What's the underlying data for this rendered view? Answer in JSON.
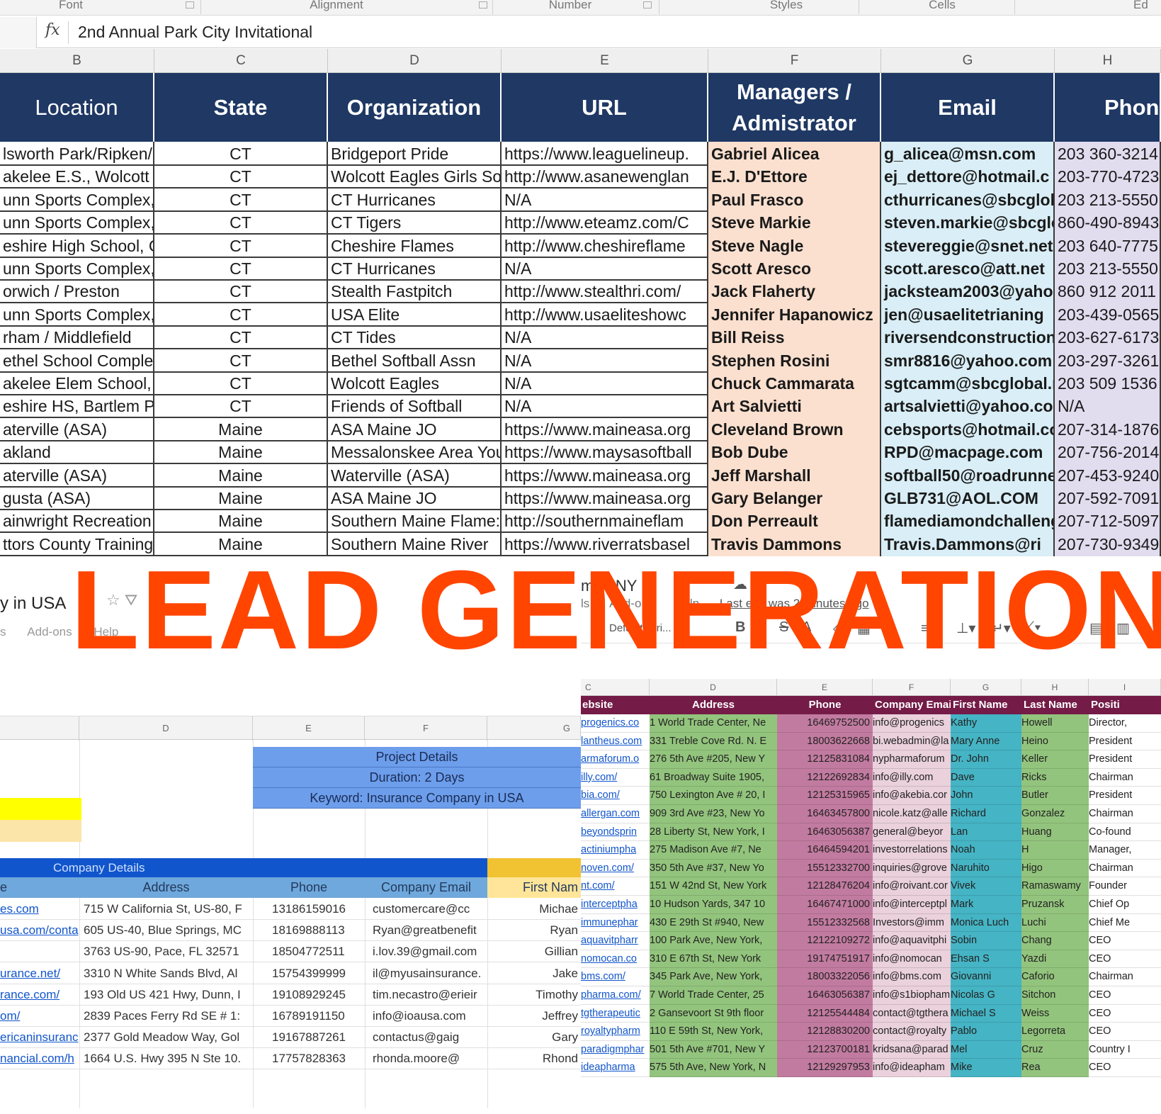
{
  "excel": {
    "ribbon_groups": [
      "Font",
      "Alignment",
      "Number",
      "Styles",
      "Cells",
      "Ed"
    ],
    "formula_bar": {
      "fx": "fx",
      "content": "2nd Annual Park City Invitational"
    },
    "column_letters": [
      "B",
      "C",
      "D",
      "E",
      "F",
      "G",
      "H"
    ],
    "headers": [
      "Location",
      "State",
      "Organization",
      "URL",
      "Managers / Admistrator",
      "Email",
      "Phon"
    ],
    "rows": [
      [
        "lsworth Park/Ripken/",
        "CT",
        "Bridgeport Pride",
        "https://www.leaguelineup.",
        "Gabriel Alicea",
        "g_alicea@msn.com",
        "203 360-3214"
      ],
      [
        "akelee E.S., Wolcott",
        "CT",
        "Wolcott Eagles Girls So",
        "http://www.asanewenglan",
        "E.J. D'Ettore",
        "ej_dettore@hotmail.c",
        "203-770-4723"
      ],
      [
        "unn Sports Complex, I",
        "CT",
        "CT Hurricanes",
        "N/A",
        "Paul Frasco",
        "cthurricanes@sbcgloba",
        "203 213-5550"
      ],
      [
        "unn Sports Complex, I",
        "CT",
        "CT Tigers",
        "http://www.eteamz.com/C",
        "Steve Markie",
        "steven.markie@sbcglo",
        "860-490-8943"
      ],
      [
        "eshire High School, C",
        "CT",
        "Cheshire Flames",
        "http://www.cheshireflame",
        "Steve Nagle",
        "stevereggie@snet.net",
        "203 640-7775"
      ],
      [
        "unn Sports Complex, I",
        "CT",
        "CT Hurricanes",
        "N/A",
        "Scott Aresco",
        "scott.aresco@att.net",
        "203 213-5550"
      ],
      [
        "orwich / Preston",
        "CT",
        "Stealth Fastpitch",
        "http://www.stealthri.com/",
        "Jack Flaherty",
        "jacksteam2003@yahoo",
        "860 912 2011"
      ],
      [
        "unn Sports Complex, I",
        "CT",
        "USA Elite",
        "http://www.usaeliteshowc",
        "Jennifer Hapanowicz",
        "jen@usaelitetrianing",
        "203-439-0565"
      ],
      [
        "rham / Middlefield",
        "CT",
        "CT Tides",
        "N/A",
        "Bill Reiss",
        "riversendconstruction(",
        "203-627-6173"
      ],
      [
        "ethel School Complex",
        "CT",
        "Bethel Softball Assn",
        "N/A",
        "Stephen Rosini",
        "smr8816@yahoo.com",
        "203-297-3261"
      ],
      [
        "akelee Elem School, '",
        "CT",
        "Wolcott Eagles",
        "N/A",
        "Chuck Cammarata",
        "sgtcamm@sbcglobal.n",
        "203 509 1536"
      ],
      [
        "eshire HS, Bartlem P",
        "CT",
        "Friends of Softball",
        "N/A",
        "Art Salvietti",
        "artsalvietti@yahoo.cor",
        "N/A"
      ],
      [
        "aterville (ASA)",
        "Maine",
        "ASA Maine JO",
        "https://www.maineasa.org",
        "Cleveland Brown",
        "cebsports@hotmail.co",
        "207-314-1876"
      ],
      [
        "akland",
        "Maine",
        "Messalonskee Area You",
        "https://www.maysasoftball",
        "Bob Dube",
        "RPD@macpage.com",
        "207-756-2014"
      ],
      [
        "aterville (ASA)",
        "Maine",
        "Waterville (ASA)",
        "https://www.maineasa.org",
        "Jeff Marshall",
        "softball50@roadrunne",
        "207-453-9240"
      ],
      [
        "gusta (ASA)",
        "Maine",
        "ASA Maine JO",
        "https://www.maineasa.org",
        "Gary Belanger",
        "GLB731@AOL.COM",
        "207-592-7091"
      ],
      [
        "ainwright Recreation",
        "Maine",
        "Southern Maine Flame:",
        "http://southernmaineflam",
        "Don Perreault",
        "flamediamondchalleng",
        "207-712-5097"
      ],
      [
        "ttors County Training",
        "Maine",
        "Southern Maine River",
        "https://www.riverratsbasel",
        "Travis Dammons",
        "Travis.Dammons@ri",
        "207-730-9349"
      ]
    ]
  },
  "overlay_title": "LEAD GENERATION",
  "sheet_left": {
    "title": "y in USA",
    "menu": [
      "s",
      "Add-ons",
      "Help"
    ],
    "column_letters": [
      "D",
      "E",
      "F",
      "G"
    ],
    "project": [
      "Project Details",
      "Duration: 2 Days",
      "Keyword: Insurance Company in USA"
    ],
    "company_details": "Company Details",
    "headers": [
      "e",
      "Address",
      "Phone",
      "Company Email",
      "First Nam"
    ],
    "rows": [
      [
        "es.com",
        "715 W California St, US-80, F",
        "13186159016",
        "customercare@cc",
        "Michae"
      ],
      [
        "usa.com/conta",
        "605 US-40, Blue Springs, MC",
        "18169888113",
        "Ryan@greatbenefit",
        "Ryan"
      ],
      [
        "",
        "3763 US-90, Pace, FL 32571",
        "18504772511",
        "i.lov.39@gmail.com",
        "Gillian"
      ],
      [
        "urance.net/",
        "3310 N White Sands Blvd, Al",
        "15754399999",
        "il@myusainsurance.",
        "Jake"
      ],
      [
        "rance.com/",
        "193 Old US 421 Hwy, Dunn, I",
        "19108929245",
        "tim.necastro@erieir",
        "Timothy"
      ],
      [
        "om/",
        "2839 Paces Ferry Rd SE # 1:",
        "16789191150",
        "info@ioausa.com",
        "Jeffrey"
      ],
      [
        "ericaninsuranc",
        "2377 Gold Meadow Way, Gol",
        "19167887261",
        "contactus@gaig",
        "Gary"
      ],
      [
        "nancial.com/h",
        "1664 U.S. Hwy 395 N Ste 10.",
        "17757828363",
        "rhonda.moore@",
        "Rhond"
      ]
    ]
  },
  "sheet_right": {
    "title": "mp   , NY",
    "menu": [
      "ls",
      "Add-ons",
      "Help",
      "Last edit was 2 minutes ago"
    ],
    "font_box": "Default (Ari...",
    "column_letters": [
      "C",
      "D",
      "E",
      "F",
      "G",
      "H",
      "I"
    ],
    "headers": [
      "ebsite",
      "Address",
      "Phone",
      "Company Email",
      "First Name",
      "Last Name",
      "Positi"
    ],
    "rows": [
      [
        "progenics.co",
        "1 World Trade Center, Ne",
        "16469752500",
        "info@progenics",
        "Kathy",
        "Howell",
        "Director,"
      ],
      [
        "lantheus.com",
        "331 Treble Cove Rd. N. E",
        "18003622668",
        "bi.webadmin@la",
        "Mary Anne",
        "Heino",
        "President"
      ],
      [
        "armaforum.o",
        "276 5th Ave #205, New Y",
        "12125831084",
        "nypharmaforum",
        "Dr. John",
        "Keller",
        "President"
      ],
      [
        "illy.com/",
        "61 Broadway Suite 1905,",
        "12122692834",
        "info@illy.com",
        "Dave",
        "Ricks",
        "Chairman"
      ],
      [
        "bia.com/",
        "750 Lexington Ave # 20, I",
        "12125315965",
        "info@akebia.cor",
        "John",
        "Butler",
        "President"
      ],
      [
        "allergan.com",
        "909 3rd Ave #23, New Yo",
        "16463457800",
        "nicole.katz@alle",
        "Richard",
        "Gonzalez",
        "Chairman"
      ],
      [
        "beyondsprin",
        "28 Liberty St, New York, I",
        "16463056387",
        "general@beyor",
        "Lan",
        "Huang",
        "Co-found"
      ],
      [
        "actiniumpha",
        "275 Madison Ave #7, Ne",
        "16464594201",
        "investorrelations",
        "Noah",
        "H",
        "Manager,"
      ],
      [
        "noven.com/",
        "350 5th Ave #37, New Yo",
        "15512332700",
        "inquiries@grove",
        "Naruhito",
        "Higo",
        "Chairman"
      ],
      [
        "nt.com/",
        "151 W 42nd St, New York",
        "12128476204",
        "info@roivant.cor",
        "Vivek",
        "Ramaswamy",
        "Founder"
      ],
      [
        "interceptpha",
        "10 Hudson Yards, 347 10",
        "16467471000",
        "info@interceptpl",
        "Mark",
        "Pruzansk",
        "Chief Op"
      ],
      [
        "immunephar",
        "430 E 29th St #940, New",
        "15512332568",
        "Investors@imm",
        "Monica Luch",
        "Luchi",
        "Chief Me"
      ],
      [
        "aquavitpharr",
        "100 Park Ave, New York,",
        "12122109272",
        "info@aquavitphi",
        "Sobin",
        "Chang",
        "CEO"
      ],
      [
        "nomocan.co",
        "310 E 67th St, New York",
        "19174751917",
        "info@nomocan",
        "Ehsan S",
        "Yazdi",
        "CEO"
      ],
      [
        "bms.com/",
        "345 Park Ave, New York,",
        "18003322056",
        "info@bms.com",
        "Giovanni",
        "Caforio",
        "Chairman"
      ],
      [
        "pharma.com/",
        "7 World Trade Center, 25",
        "16463056387",
        "info@s1biopham",
        "Nicolas G",
        "Sitchon",
        "CEO"
      ],
      [
        "tgtherapeutic",
        "2 Gansevoort St 9th floor",
        "12125544484",
        "contact@tgthera",
        "Michael S",
        "Weiss",
        "CEO"
      ],
      [
        "royaltypharm",
        "110 E 59th St, New York,",
        "12128830200",
        "contact@royalty",
        "Pablo",
        "Legorreta",
        "CEO"
      ],
      [
        "paradigmphar",
        "501 5th Ave #701, New Y",
        "12123700181",
        "kridsana@parad",
        "Mel",
        "Cruz",
        "Country I"
      ],
      [
        "ideapharma",
        "575 5th Ave, New York, N",
        "12129297953",
        "info@ideapham",
        "Mike",
        "Rea",
        "CEO"
      ]
    ]
  },
  "colors": {
    "excel_header": "#1f3864",
    "lead_title": "#ff4500",
    "right_header": "#741b47",
    "project_blue": "#6d9eeb",
    "company_bar": "#1155cc"
  }
}
